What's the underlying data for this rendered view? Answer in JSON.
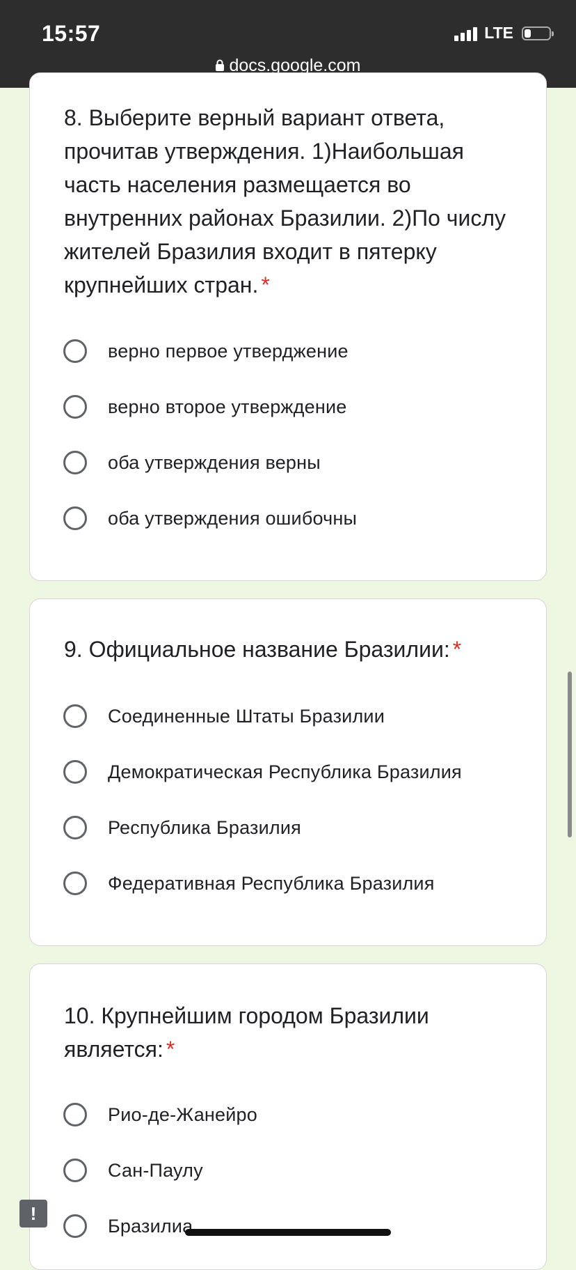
{
  "status_bar": {
    "time": "15:57",
    "network": "LTE",
    "signal_bars": 4,
    "battery_level": 0.25
  },
  "browser": {
    "url": "docs.google.com"
  },
  "questions": [
    {
      "title": "8. Выберите верный вариант ответа, прочитав утверждения. 1)Наибольшая часть населения размещается во внутренних районах Бразилии. 2)По числу жителей Бразилия входит в пятерку крупнейших стран.",
      "required_mark": "*",
      "options": [
        "верно первое утверджение",
        "верно второе утверждение",
        "оба утверждения верны",
        "оба утверждения ошибочны"
      ]
    },
    {
      "title": "9. Официальное название Бразилии:",
      "required_mark": "*",
      "options": [
        "Соединенные Штаты Бразилии",
        "Демократическая Республика Бразилия",
        "Республика Бразилия",
        "Федеративная Республика Бразилия"
      ]
    },
    {
      "title": "10. Крупнейшим городом Бразилии является:",
      "required_mark": "*",
      "options": [
        "Рио-де-Жанейро",
        "Сан-Паулу",
        "Бразилиа"
      ]
    }
  ],
  "colors": {
    "page_background": "#eef7e2",
    "status_bar": "#2d2d2d",
    "required": "#d93025",
    "radio_border": "#5f6368"
  },
  "icons": {
    "lock": "lock-icon",
    "feedback": "feedback-icon"
  }
}
